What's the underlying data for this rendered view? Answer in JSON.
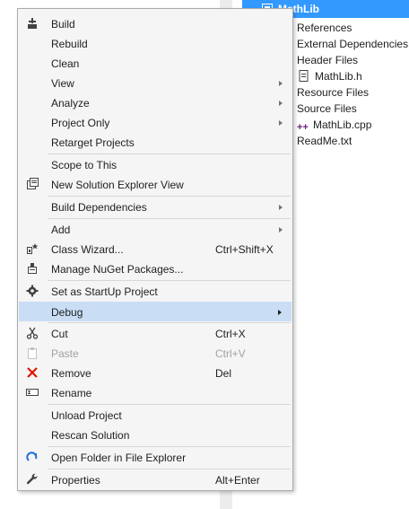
{
  "explorer": {
    "project_name": "MathLib",
    "tree": [
      {
        "label": "References",
        "icon": ""
      },
      {
        "label": "External Dependencies",
        "icon": ""
      },
      {
        "label": "Header Files",
        "icon": ""
      },
      {
        "label": "MathLib.h",
        "icon": "header-file-icon"
      },
      {
        "label": "Resource Files",
        "icon": ""
      },
      {
        "label": "Source Files",
        "icon": ""
      },
      {
        "label": "MathLib.cpp",
        "icon": "cpp-file-icon"
      },
      {
        "label": "ReadMe.txt",
        "icon": ""
      }
    ]
  },
  "menu": {
    "items": [
      {
        "label": "Build",
        "icon": "build-icon"
      },
      {
        "label": "Rebuild"
      },
      {
        "label": "Clean"
      },
      {
        "label": "View",
        "submenu": true
      },
      {
        "label": "Analyze",
        "submenu": true
      },
      {
        "label": "Project Only",
        "submenu": true
      },
      {
        "label": "Retarget Projects"
      },
      {
        "label": "Scope to This"
      },
      {
        "label": "New Solution Explorer View",
        "icon": "new-view-icon"
      },
      {
        "label": "Build Dependencies",
        "submenu": true
      },
      {
        "label": "Add",
        "submenu": true
      },
      {
        "label": "Class Wizard...",
        "icon": "class-wizard-icon",
        "shortcut": "Ctrl+Shift+X"
      },
      {
        "label": "Manage NuGet Packages...",
        "icon": "nuget-icon"
      },
      {
        "label": "Set as StartUp Project",
        "icon": "gear-icon"
      },
      {
        "label": "Debug",
        "submenu": true,
        "highlighted": true
      },
      {
        "label": "Cut",
        "icon": "scissors-icon",
        "shortcut": "Ctrl+X"
      },
      {
        "label": "Paste",
        "icon": "paste-icon",
        "shortcut": "Ctrl+V",
        "disabled": true
      },
      {
        "label": "Remove",
        "icon": "remove-x-icon",
        "shortcut": "Del"
      },
      {
        "label": "Rename",
        "icon": "rename-icon"
      },
      {
        "label": "Unload Project"
      },
      {
        "label": "Rescan Solution"
      },
      {
        "label": "Open Folder in File Explorer",
        "icon": "refresh-arrow-icon"
      },
      {
        "label": "Properties",
        "icon": "wrench-icon",
        "shortcut": "Alt+Enter"
      }
    ]
  },
  "colors": {
    "highlight": "#c9def5",
    "selection": "#3399ff",
    "remove_red": "#e51400",
    "cpp_purple": "#68217a"
  }
}
